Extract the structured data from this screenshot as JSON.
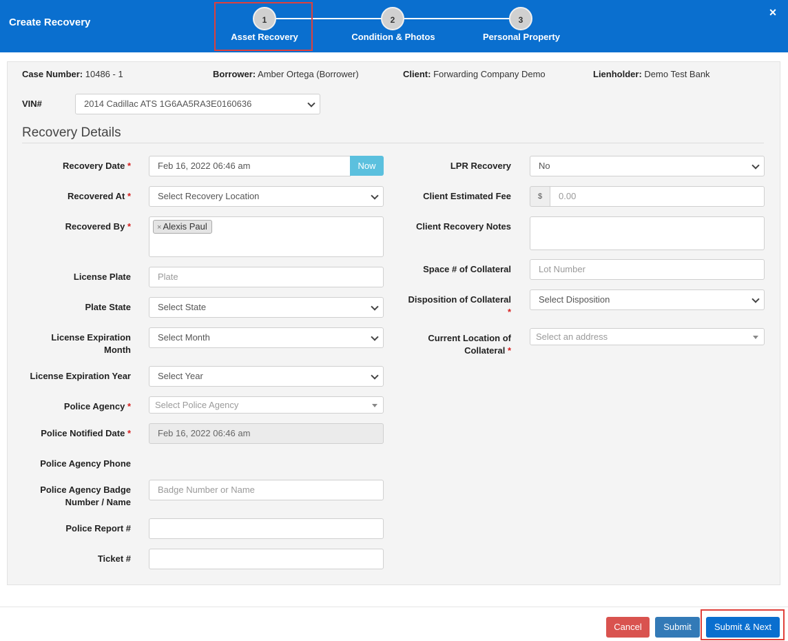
{
  "header": {
    "title": "Create Recovery",
    "close_icon": "×",
    "steps": [
      {
        "number": "1",
        "label": "Asset Recovery"
      },
      {
        "number": "2",
        "label": "Condition & Photos"
      },
      {
        "number": "3",
        "label": "Personal Property"
      }
    ]
  },
  "case_info": {
    "case_number_label": "Case Number:",
    "case_number": "10486 - 1",
    "borrower_label": "Borrower:",
    "borrower": "Amber Ortega (Borrower)",
    "client_label": "Client:",
    "client": "Forwarding Company Demo",
    "lienholder_label": "Lienholder:",
    "lienholder": "Demo Test Bank",
    "vin_label": "VIN#",
    "vin_value": "2014 Cadillac ATS 1G6AA5RA3E0160636"
  },
  "section_title": "Recovery Details",
  "required_mark": "*",
  "left_fields": {
    "recovery_date": {
      "label": "Recovery Date",
      "value": "Feb 16, 2022 06:46 am",
      "button": "Now"
    },
    "recovered_at": {
      "label": "Recovered At",
      "value": "Select Recovery Location"
    },
    "recovered_by": {
      "label": "Recovered By",
      "tag": "Alexis Paul",
      "tag_remove": "×"
    },
    "license_plate": {
      "label": "License Plate",
      "placeholder": "Plate"
    },
    "plate_state": {
      "label": "Plate State",
      "value": "Select State"
    },
    "license_exp_month": {
      "label_line1": "License Expiration",
      "label_line2": "Month",
      "value": "Select Month"
    },
    "license_exp_year": {
      "label": "License Expiration Year",
      "value": "Select Year"
    },
    "police_agency": {
      "label": "Police Agency",
      "placeholder": "Select Police Agency"
    },
    "police_notified_date": {
      "label": "Police Notified Date",
      "value": "Feb 16, 2022 06:46 am"
    },
    "police_agency_phone": {
      "label": "Police Agency Phone"
    },
    "police_badge": {
      "label_line1": "Police Agency Badge",
      "label_line2": "Number / Name",
      "placeholder": "Badge Number or Name"
    },
    "police_report": {
      "label": "Police Report #",
      "value": ""
    },
    "ticket": {
      "label": "Ticket #",
      "value": ""
    }
  },
  "right_fields": {
    "lpr_recovery": {
      "label": "LPR Recovery",
      "value": "No"
    },
    "client_estimated_fee": {
      "label": "Client Estimated Fee",
      "addon": "$",
      "placeholder": "0.00"
    },
    "client_recovery_notes": {
      "label": "Client Recovery Notes",
      "value": ""
    },
    "space_number": {
      "label": "Space # of Collateral",
      "placeholder": "Lot Number"
    },
    "disposition": {
      "label": "Disposition of Collateral",
      "value": "Select Disposition"
    },
    "current_location": {
      "label_line1": "Current Location of",
      "label_line2": "Collateral",
      "placeholder": "Select an address"
    }
  },
  "footer": {
    "cancel": "Cancel",
    "submit": "Submit",
    "submit_next": "Submit & Next"
  },
  "colors": {
    "header_bg": "#0a6fcf",
    "now_button": "#5bc0de",
    "cancel_button": "#d9534f",
    "submit_button": "#337ab7",
    "submit_next_button": "#0a6fcf",
    "highlight_box": "#e0403a",
    "required": "#d62020"
  }
}
